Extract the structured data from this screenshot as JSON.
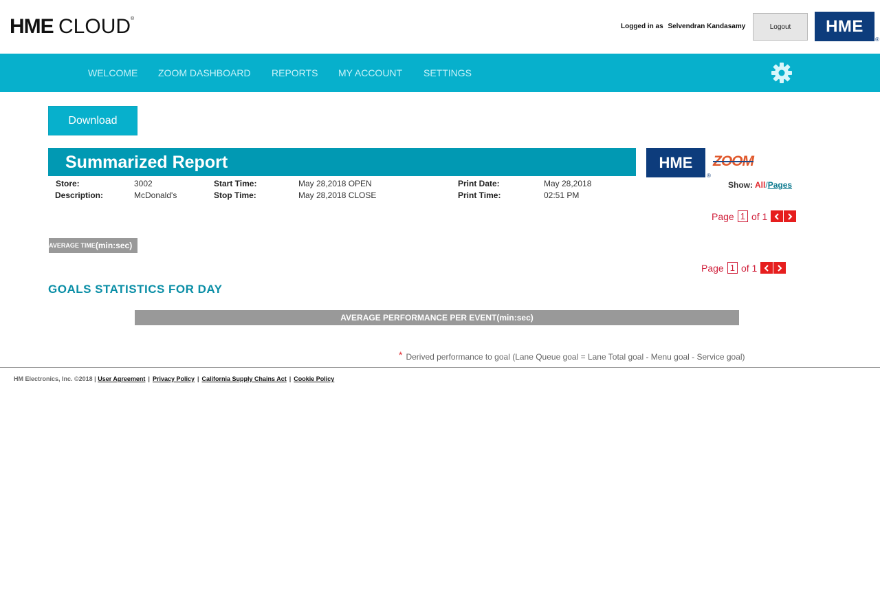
{
  "header": {
    "logo_hme": "HME",
    "logo_cloud": "CLOUD",
    "logo_reg": "®",
    "logged_in_label": "Logged in as",
    "user_name": "Selvendran Kandasamy",
    "logout_label": "Logout",
    "hme_badge": "HME",
    "hme_reg": "®"
  },
  "nav": {
    "items": [
      "WELCOME",
      "ZOOM DASHBOARD",
      "REPORTS",
      "MY ACCOUNT",
      "SETTINGS"
    ],
    "settings_icon": "gear-icon"
  },
  "toolbar": {
    "download_label": "Download"
  },
  "report": {
    "title": "Summarized Report",
    "hme_badge": "HME",
    "hme_reg": "®",
    "zoom_logo": "ZOOM",
    "store_label": "Store:",
    "store_value": "3002",
    "description_label": "Description:",
    "description_value": "McDonald's",
    "start_time_label": "Start Time:",
    "start_time_value": "May 28,2018 OPEN",
    "stop_time_label": "Stop Time:",
    "stop_time_value": "May 28,2018 CLOSE",
    "print_date_label": "Print Date:",
    "print_date_value": "May 28,2018",
    "print_time_label": "Print Time:",
    "print_time_value": "02:51 PM",
    "show_label": "Show:",
    "show_all": "All",
    "show_sep": "/",
    "show_pages": "Pages"
  },
  "pager": {
    "page_label": "Page",
    "current": "1",
    "of_label": "of 1",
    "prev_icon": "chevron-left-icon",
    "next_icon": "chevron-right-icon"
  },
  "avg_time": {
    "label_small": "AVERAGE TIME",
    "label_unit": "(min:sec)"
  },
  "goals": {
    "heading": "GOALS STATISTICS FOR DAY",
    "avg_perf_header": "AVERAGE PERFORMANCE PER EVENT(min:sec)",
    "footnote_star": "*",
    "footnote_text": "Derived performance to goal (Lane Queue goal = Lane Total goal - Menu goal - Service goal)"
  },
  "footer": {
    "copyright": "HM Electronics, Inc. ©2018 |",
    "links": [
      "User Agreement",
      "Privacy Policy",
      "California Supply Chains Act",
      "Cookie Policy"
    ],
    "separator": "|"
  },
  "colors": {
    "nav_bg": "#07b0cc",
    "banner_bg": "#0199b3",
    "hme_blue": "#0d3c7c",
    "pager_red": "#d01f3a",
    "gray_header": "#999999",
    "goals_teal": "#0a8ea6"
  }
}
